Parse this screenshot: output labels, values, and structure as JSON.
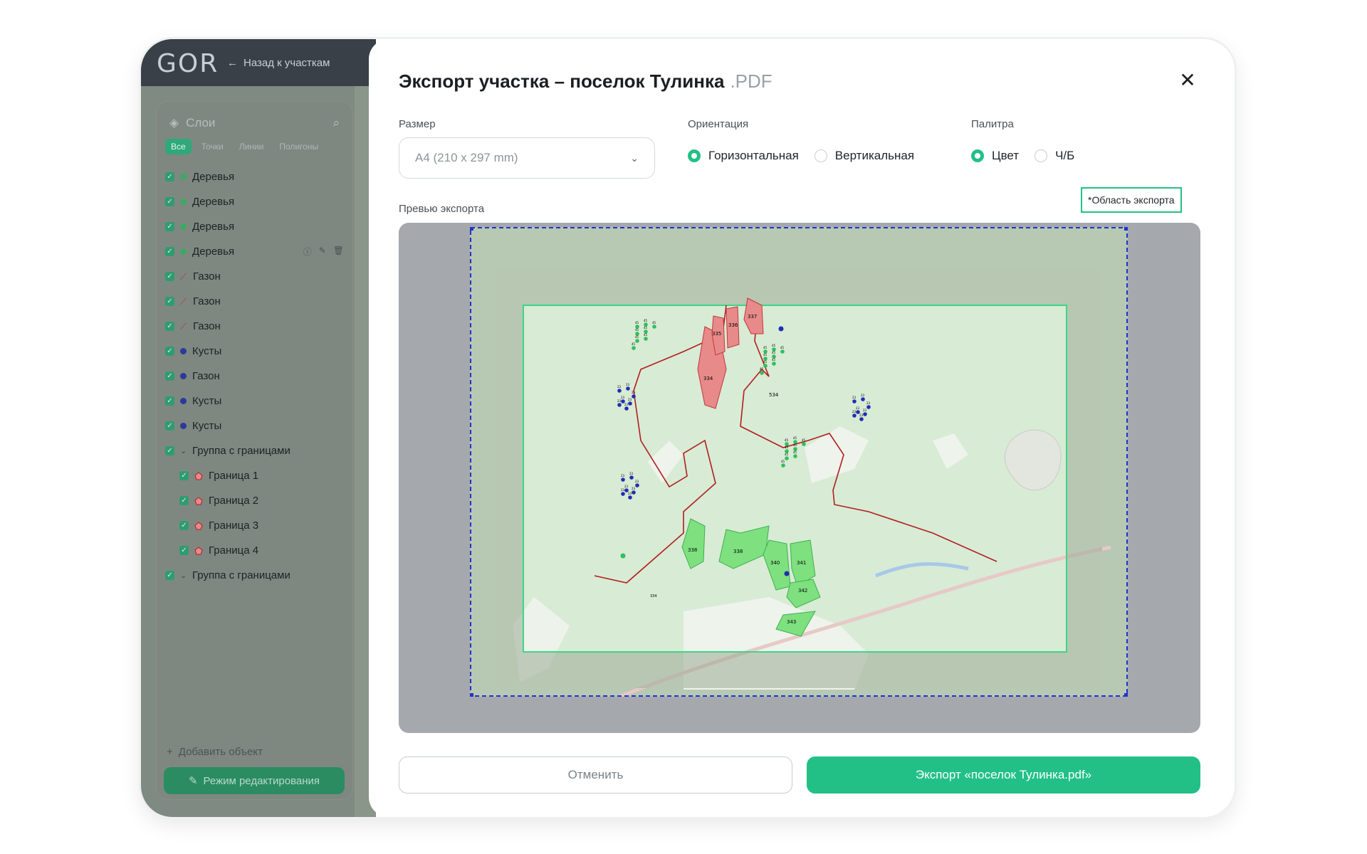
{
  "app": {
    "logo": "GOR",
    "back_link": "Назад к участкам"
  },
  "layers_panel": {
    "title": "Слои",
    "filters": [
      "Все",
      "Точки",
      "Линии",
      "Полигоны"
    ],
    "items": [
      {
        "label": "Деревья",
        "icon": "green-dot-icon",
        "child": false
      },
      {
        "label": "Деревья",
        "icon": "green-dot-icon",
        "child": false
      },
      {
        "label": "Деревья",
        "icon": "green-dot-icon",
        "child": false
      },
      {
        "label": "Деревья",
        "icon": "green-dot-icon",
        "child": false,
        "hover": true
      },
      {
        "label": "Газон",
        "icon": "line-icon",
        "child": false
      },
      {
        "label": "Газон",
        "icon": "line-icon",
        "child": false
      },
      {
        "label": "Газон",
        "icon": "line-icon",
        "child": false
      },
      {
        "label": "Кусты",
        "icon": "blue-dot-icon",
        "child": false
      },
      {
        "label": "Газон",
        "icon": "blue-dot-icon",
        "child": false
      },
      {
        "label": "Кусты",
        "icon": "blue-dot-icon",
        "child": false
      },
      {
        "label": "Кусты",
        "icon": "blue-dot-icon",
        "child": false
      },
      {
        "label": "Группа с границами",
        "icon": "chevron-down-icon",
        "child": false
      },
      {
        "label": "Граница 1",
        "icon": "polygon-icon",
        "child": true
      },
      {
        "label": "Граница 2",
        "icon": "polygon-icon",
        "child": true
      },
      {
        "label": "Граница 3",
        "icon": "polygon-icon",
        "child": true
      },
      {
        "label": "Граница 4",
        "icon": "polygon-icon",
        "child": true
      },
      {
        "label": "Группа с границами",
        "icon": "chevron-down-icon",
        "child": false
      }
    ],
    "add_object": "Добавить объект",
    "edit_mode": "Режим редактирования"
  },
  "modal": {
    "title": "Экспорт участка – поселок Тулинка",
    "title_ext": ".PDF",
    "size_label": "Размер",
    "size_value": "A4 (210 x 297 mm)",
    "orientation_label": "Ориентация",
    "orientation_options": [
      {
        "label": "Горизонтальная",
        "selected": true
      },
      {
        "label": "Вертикальная",
        "selected": false
      }
    ],
    "palette_label": "Палитра",
    "palette_options": [
      {
        "label": "Цвет",
        "selected": true
      },
      {
        "label": "Ч/Б",
        "selected": false
      }
    ],
    "export_area_badge": "*Область экспорта",
    "preview_label": "Превью экспорта",
    "cancel_button": "Отменить",
    "export_button": "Экспорт «поселок Тулинка.pdf»"
  },
  "map_labels": {
    "red_parcels": [
      "334",
      "335",
      "336",
      "337"
    ],
    "green_parcels": [
      "338",
      "338",
      "340",
      "341",
      "342",
      "343"
    ],
    "boundary_label": "534",
    "point_labels": [
      "45",
      "23",
      "334"
    ]
  },
  "colors": {
    "accent": "#22c087",
    "export_frame": "#2233cc",
    "red_parcel": "#e88a8a",
    "green_parcel": "#7ee07e",
    "boundary_line": "#b01e1e"
  }
}
